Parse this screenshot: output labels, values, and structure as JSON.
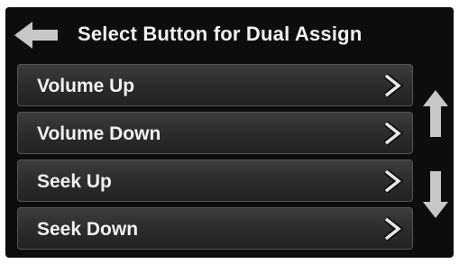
{
  "header": {
    "title": "Select Button for Dual Assign",
    "back_icon": "arrow-left-icon"
  },
  "items": [
    {
      "label": "Volume Up",
      "icon": "chevron-right-icon"
    },
    {
      "label": "Volume Down",
      "icon": "chevron-right-icon"
    },
    {
      "label": "Seek Up",
      "icon": "chevron-right-icon"
    },
    {
      "label": "Seek Down",
      "icon": "chevron-right-icon"
    }
  ],
  "scroll": {
    "up_icon": "arrow-up-icon",
    "down_icon": "arrow-down-icon"
  },
  "colors": {
    "background": "#0d0d0d",
    "text": "#f2f2f2",
    "icon": "#e6e6e6",
    "arrow": "#c8c8c8"
  }
}
